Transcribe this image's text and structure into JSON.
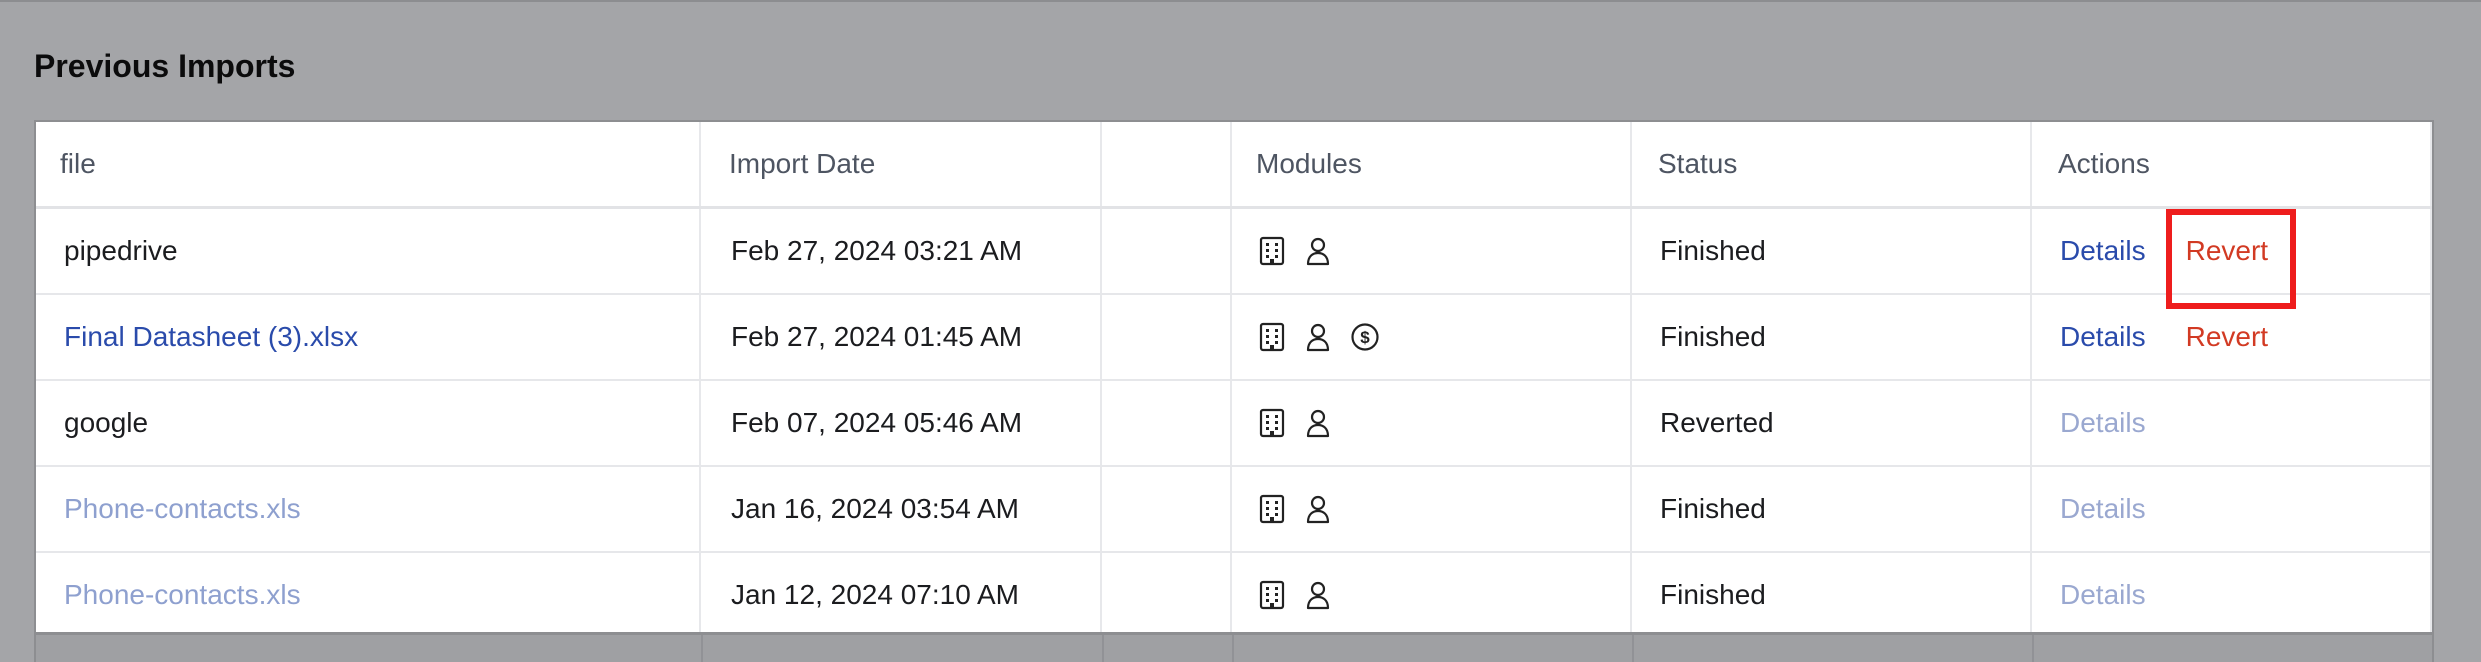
{
  "section": {
    "title": "Previous Imports"
  },
  "table": {
    "columns": {
      "file": "file",
      "import_date": "Import Date",
      "blank": "",
      "modules": "Modules",
      "status": "Status",
      "actions": "Actions"
    },
    "rows": [
      {
        "file": "pipedrive",
        "import_date": "Feb 27, 2024 03:21 AM",
        "modules": [
          "building-icon",
          "person-icon"
        ],
        "status": "Finished",
        "details": "Details",
        "revert": "Revert"
      },
      {
        "file": "Final Datasheet (3).xlsx",
        "import_date": "Feb 27, 2024 01:45 AM",
        "modules": [
          "building-icon",
          "person-icon",
          "dollar-circle-icon"
        ],
        "status": "Finished",
        "details": "Details",
        "revert": "Revert"
      },
      {
        "file": "google",
        "import_date": "Feb 07, 2024 05:46 AM",
        "modules": [
          "building-icon",
          "person-icon"
        ],
        "status": "Reverted",
        "details": "Details"
      },
      {
        "file": "Phone-contacts.xls",
        "import_date": "Jan 16, 2024 03:54 AM",
        "modules": [
          "building-icon",
          "person-icon"
        ],
        "status": "Finished",
        "details": "Details"
      },
      {
        "file": "Phone-contacts.xls",
        "import_date": "Jan 12, 2024 07:10 AM",
        "modules": [
          "building-icon",
          "person-icon"
        ],
        "status": "Finished",
        "details": "Details"
      }
    ]
  },
  "colors": {
    "link_blue": "#2a4bab",
    "muted_blue": "#8ea0cf",
    "revert_red": "#d23a23",
    "highlight_red": "#ee1d1d",
    "overlay_gray": "#a4a5a8"
  }
}
